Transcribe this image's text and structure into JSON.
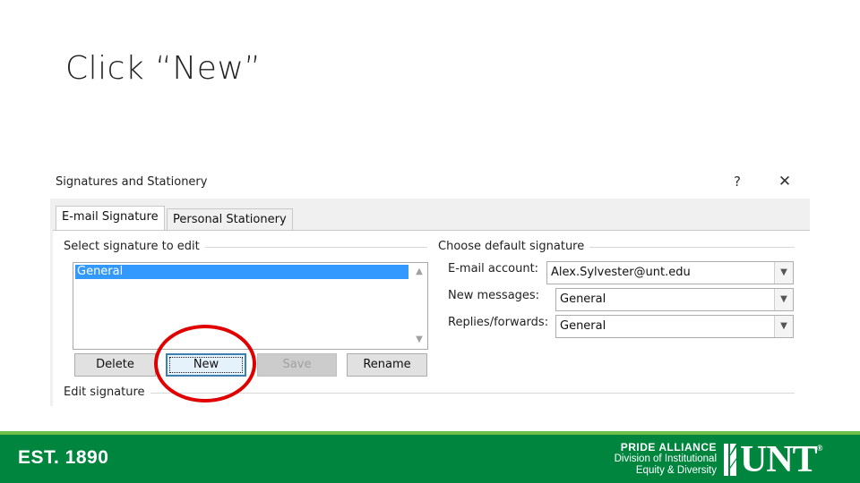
{
  "slide": {
    "title": "Click “New”"
  },
  "dialog": {
    "title": "Signatures and Stationery",
    "help_label": "?",
    "close_label": "✕",
    "tabs": [
      {
        "label": "E-mail Signature",
        "active": true
      },
      {
        "label": "Personal Stationery",
        "active": false
      }
    ],
    "select_group_label": "Select signature to edit",
    "signatures": [
      "General"
    ],
    "buttons": {
      "delete": "Delete",
      "new": "New",
      "save": "Save",
      "rename": "Rename"
    },
    "edit_group_label": "Edit signature",
    "default_group_label": "Choose default signature",
    "email_account_label": "E-mail account:",
    "email_account_value": "Alex.Sylvester@unt.edu",
    "new_messages_label": "New messages:",
    "new_messages_value": "General",
    "replies_label": "Replies/forwards:",
    "replies_value": "General"
  },
  "highlight": {
    "color": "#e00000",
    "target": "new-button"
  },
  "footer": {
    "est": "EST. 1890",
    "pride_alliance": "PRIDE ALLIANCE",
    "division_line1": "Division of Institutional",
    "division_line2": "Equity & Diversity",
    "unt": "UNT",
    "registered": "®",
    "bg_color": "#00853e",
    "accent_color": "#6fbf4a"
  }
}
